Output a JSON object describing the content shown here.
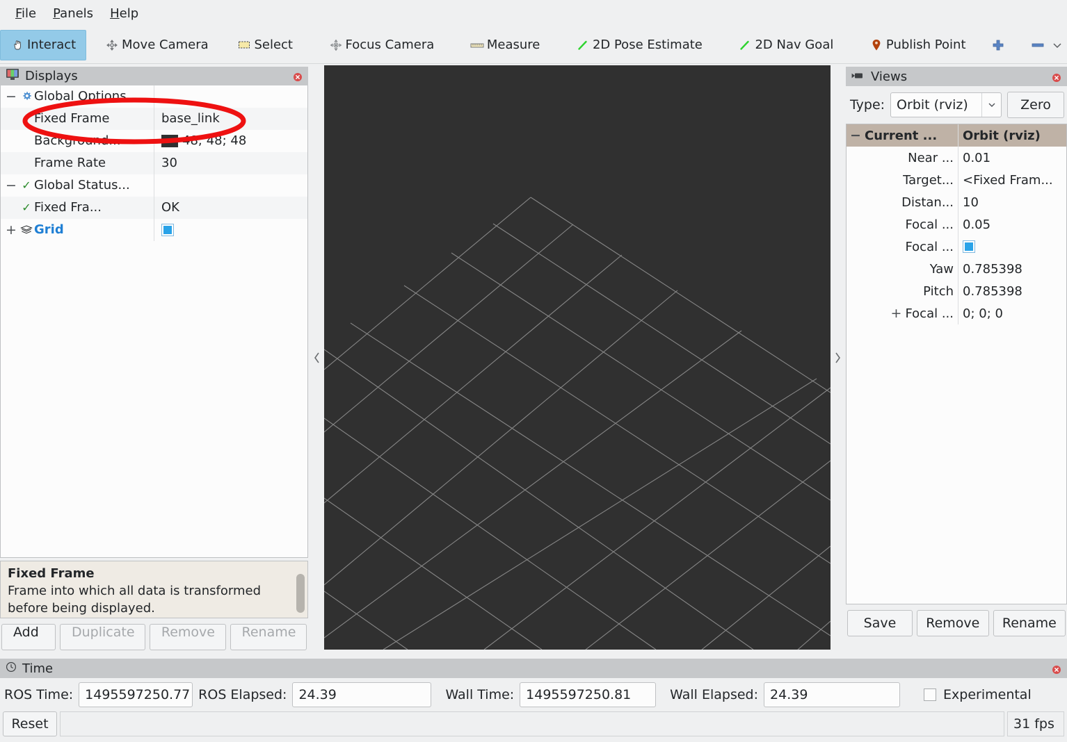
{
  "menubar": {
    "items": [
      {
        "label": "File",
        "mnemonic": "F"
      },
      {
        "label": "Panels",
        "mnemonic": "P"
      },
      {
        "label": "Help",
        "mnemonic": "H"
      }
    ]
  },
  "toolbar": {
    "tools": [
      {
        "label": "Interact",
        "icon": "hand-cursor-icon",
        "active": true
      },
      {
        "label": "Move Camera",
        "icon": "move-camera-icon",
        "active": false
      },
      {
        "label": "Select",
        "icon": "select-rect-icon",
        "active": false
      },
      {
        "label": "Focus Camera",
        "icon": "focus-camera-icon",
        "active": false
      },
      {
        "label": "Measure",
        "icon": "ruler-icon",
        "active": false
      },
      {
        "label": "2D Pose Estimate",
        "icon": "green-arrow-icon",
        "active": false
      },
      {
        "label": "2D Nav Goal",
        "icon": "green-arrow-icon",
        "active": false
      },
      {
        "label": "Publish Point",
        "icon": "map-pin-icon",
        "active": false
      }
    ],
    "add_tool_icon": "plus-icon",
    "remove_tool_icon": "minus-icon",
    "overflow_icon": "chevron-down-icon"
  },
  "displays": {
    "title": "Displays",
    "title_icon": "monitor-rgb-icon",
    "close_icon": "close-icon",
    "rows": [
      {
        "expander": "−",
        "icon": "gear-icon",
        "label": "Global Options",
        "value": "",
        "indent": 0,
        "bold": false,
        "blue": false,
        "valueKind": "text"
      },
      {
        "expander": "",
        "icon": "",
        "label": "Fixed Frame",
        "value": "base_link",
        "indent": 1,
        "bold": false,
        "blue": false,
        "valueKind": "text"
      },
      {
        "expander": "",
        "icon": "",
        "label": "Background...",
        "value": "48; 48; 48",
        "indent": 1,
        "bold": false,
        "blue": false,
        "valueKind": "color"
      },
      {
        "expander": "",
        "icon": "",
        "label": "Frame Rate",
        "value": "30",
        "indent": 1,
        "bold": false,
        "blue": false,
        "valueKind": "text"
      },
      {
        "expander": "−",
        "icon": "check-icon",
        "label": "Global Status...",
        "value": "",
        "indent": 0,
        "bold": false,
        "blue": false,
        "valueKind": "text"
      },
      {
        "expander": "",
        "icon": "check-icon",
        "label": "Fixed Fra...",
        "value": "OK",
        "indent": 1,
        "bold": false,
        "blue": false,
        "valueKind": "text"
      },
      {
        "expander": "+",
        "icon": "grid-icon",
        "label": "Grid",
        "value": "",
        "indent": 0,
        "bold": true,
        "blue": true,
        "valueKind": "checkbox"
      }
    ],
    "description": {
      "title": "Fixed Frame",
      "body": "Frame into which all data is transformed before being displayed."
    },
    "buttons": [
      {
        "label": "Add",
        "enabled": true
      },
      {
        "label": "Duplicate",
        "enabled": false
      },
      {
        "label": "Remove",
        "enabled": false
      },
      {
        "label": "Rename",
        "enabled": false
      }
    ]
  },
  "viewport": {
    "background_color": "#303030",
    "grid_line_color": "#9a9a9a",
    "collapse_left_icon": "chevron-left-icon",
    "collapse_right_icon": "chevron-right-icon"
  },
  "views": {
    "title": "Views",
    "title_icon": "camera-icon",
    "close_icon": "close-icon",
    "type_label": "Type:",
    "type_value": "Orbit (rviz)",
    "zero_button": "Zero",
    "rows": [
      {
        "expander": "−",
        "label": "Current ...",
        "value": "Orbit (rviz)",
        "header": true,
        "valueKind": "text"
      },
      {
        "expander": "",
        "label": "Near ...",
        "value": "0.01",
        "header": false,
        "valueKind": "text"
      },
      {
        "expander": "",
        "label": "Target...",
        "value": "<Fixed Fram...",
        "header": false,
        "valueKind": "text"
      },
      {
        "expander": "",
        "label": "Distan...",
        "value": "10",
        "header": false,
        "valueKind": "text"
      },
      {
        "expander": "",
        "label": "Focal ...",
        "value": "0.05",
        "header": false,
        "valueKind": "text"
      },
      {
        "expander": "",
        "label": "Focal ...",
        "value": "",
        "header": false,
        "valueKind": "checkbox"
      },
      {
        "expander": "",
        "label": "Yaw",
        "value": "0.785398",
        "header": false,
        "valueKind": "text"
      },
      {
        "expander": "",
        "label": "Pitch",
        "value": "0.785398",
        "header": false,
        "valueKind": "text"
      },
      {
        "expander": "+",
        "label": "Focal ...",
        "value": "0; 0; 0",
        "header": false,
        "valueKind": "text"
      }
    ],
    "buttons": [
      {
        "label": "Save"
      },
      {
        "label": "Remove"
      },
      {
        "label": "Rename"
      }
    ]
  },
  "time": {
    "title": "Time",
    "title_icon": "clock-icon",
    "close_icon": "close-icon",
    "ros_time_label": "ROS Time:",
    "ros_time_value": "1495597250.77",
    "ros_elapsed_label": "ROS Elapsed:",
    "ros_elapsed_value": "24.39",
    "wall_time_label": "Wall Time:",
    "wall_time_value": "1495597250.81",
    "wall_elapsed_label": "Wall Elapsed:",
    "wall_elapsed_value": "24.39",
    "experimental_label": "Experimental",
    "reset_label": "Reset",
    "fps_label": "31 fps"
  },
  "annotation": {
    "shape": "ellipse",
    "color": "#ee1111",
    "target": "Fixed Frame / base_link row"
  }
}
